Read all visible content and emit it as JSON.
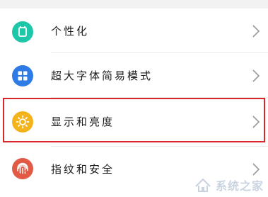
{
  "settings": {
    "items": [
      {
        "label": "个性化",
        "icon": "theme-icon",
        "icon_color": "#1ec7a8"
      },
      {
        "label": "超大字体简易模式",
        "icon": "grid-icon",
        "icon_color": "#2e7be6"
      },
      {
        "label": "显示和亮度",
        "icon": "sun-icon",
        "icon_color": "#f4b31b",
        "highlighted": true
      },
      {
        "label": "指纹和安全",
        "icon": "fingerprint-icon",
        "icon_color": "#e25a45"
      }
    ]
  },
  "watermark": {
    "text": "系统之家",
    "logo": "watermark-logo"
  },
  "colors": {
    "highlight_border": "#d8272b",
    "chevron": "#9a9a9a"
  }
}
